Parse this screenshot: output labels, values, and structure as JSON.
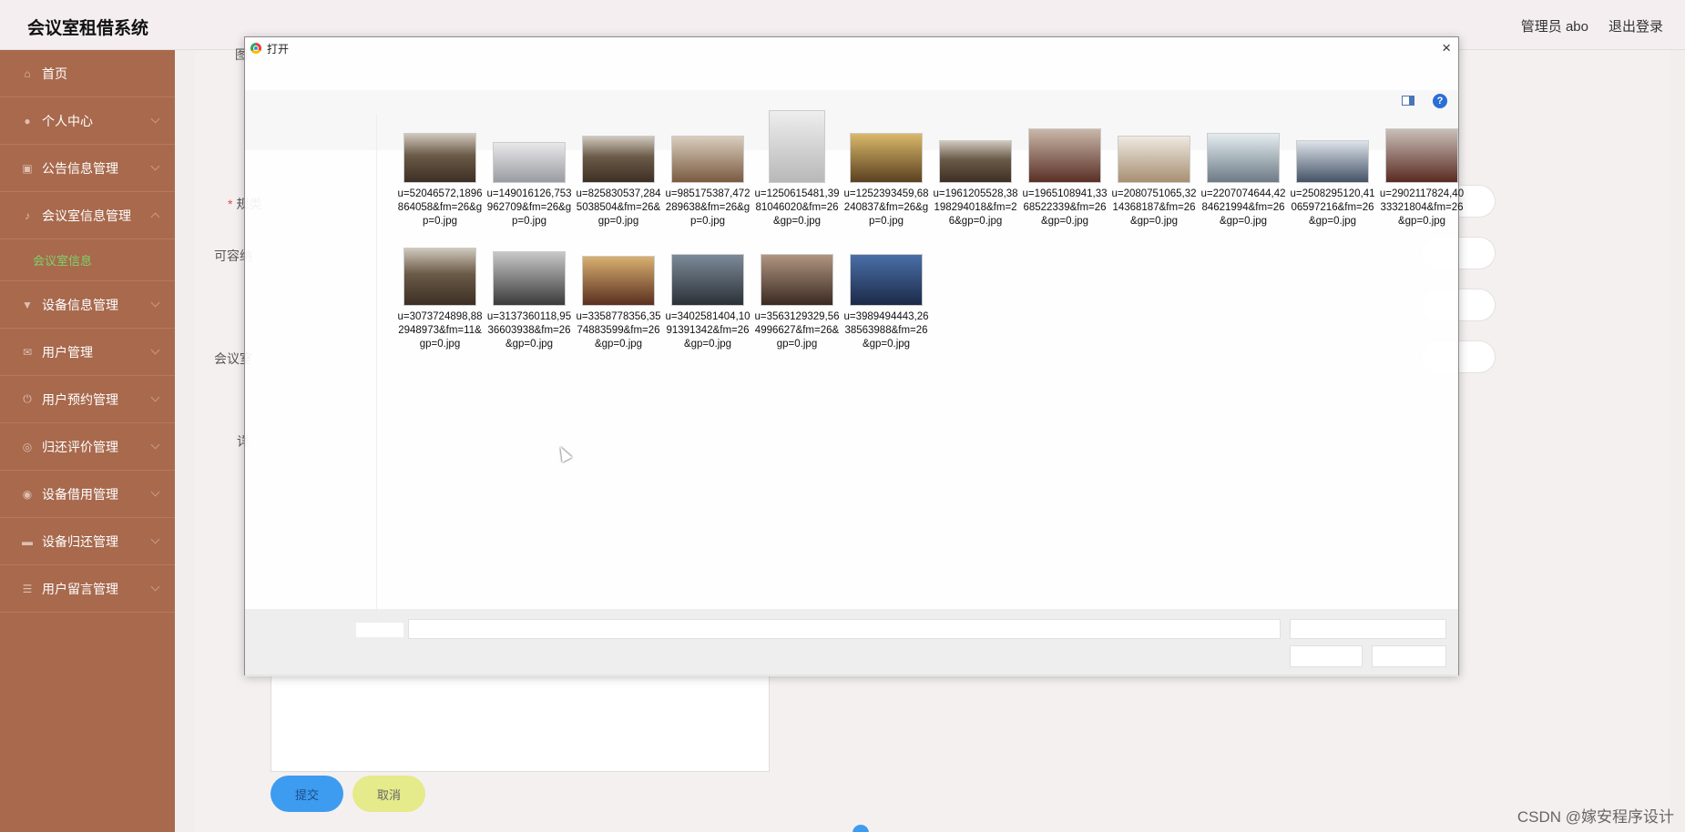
{
  "header": {
    "app_title": "会议室租借系统",
    "user_label": "管理员 abo",
    "logout_label": "退出登录"
  },
  "sidebar": {
    "items": [
      {
        "label": "首页",
        "icon": "home-icon"
      },
      {
        "label": "个人中心",
        "icon": "user-icon"
      },
      {
        "label": "公告信息管理",
        "icon": "notice-icon"
      },
      {
        "label": "会议室信息管理",
        "icon": "microphone-icon",
        "expanded": true
      },
      {
        "label": "设备信息管理",
        "icon": "device-icon"
      },
      {
        "label": "用户管理",
        "icon": "users-icon"
      },
      {
        "label": "用户预约管理",
        "icon": "power-icon"
      },
      {
        "label": "归还评价管理",
        "icon": "review-icon"
      },
      {
        "label": "设备借用管理",
        "icon": "location-icon"
      },
      {
        "label": "设备归还管理",
        "icon": "return-icon"
      },
      {
        "label": "用户留言管理",
        "icon": "message-icon"
      }
    ],
    "submenu": {
      "label": "会议室信息",
      "active_color": "#7bd36a"
    }
  },
  "form": {
    "labels": {
      "cover": "图",
      "type": "规类",
      "capacity": "可容纳",
      "status": "会议室",
      "details": "详"
    },
    "submit_label": "提交",
    "cancel_label": "取消"
  },
  "dialog": {
    "title": "打开",
    "close_glyph": "×",
    "help_glyph": "?",
    "files": [
      "u=52046572,1896864058&fm=26&gp=0.jpg",
      "u=149016126,753962709&fm=26&gp=0.jpg",
      "u=825830537,2845038504&fm=26&gp=0.jpg",
      "u=985175387,472289638&fm=26&gp=0.jpg",
      "u=1250615481,3981046020&fm=26&gp=0.jpg",
      "u=1252393459,68240837&fm=26&gp=0.jpg",
      "u=1961205528,38198294018&fm=26&gp=0.jpg",
      "u=1965108941,3368522339&fm=26&gp=0.jpg",
      "u=2080751065,3214368187&fm=26&gp=0.jpg",
      "u=2207074644,4284621994&fm=26&gp=0.jpg",
      "u=2508295120,4106597216&fm=26&gp=0.jpg",
      "u=2902117824,4033321804&fm=26&gp=0.jpg",
      "u=3073724898,882948973&fm=11&gp=0.jpg",
      "u=3137360118,9536603938&fm=26&gp=0.jpg",
      "u=3358778356,3574883599&fm=26&gp=0.jpg",
      "u=3402581404,1091391342&fm=26&gp=0.jpg",
      "u=3563129329,564996627&fm=26&gp=0.jpg",
      "u=3989494443,2638563988&fm=26&gp=0.jpg"
    ]
  },
  "watermark": "CSDN @嫁安程序设计",
  "colors": {
    "sidebar_bg": "#a8694d",
    "accent_blue": "#3d9cf0",
    "cancel_yellow": "#e5ea8a"
  }
}
